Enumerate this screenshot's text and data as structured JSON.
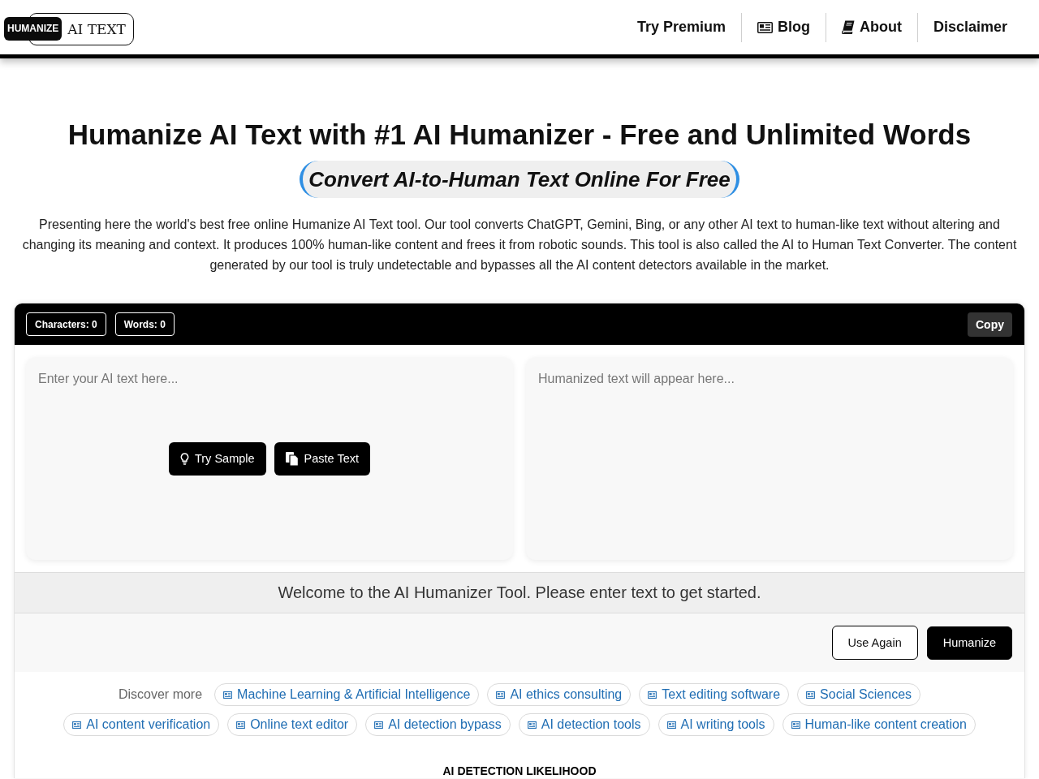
{
  "header": {
    "logo": {
      "badge": "HUMANIZE",
      "wordmark": "AI TEXT"
    },
    "nav": [
      {
        "label": "Try Premium"
      },
      {
        "label": "Blog"
      },
      {
        "label": "About"
      },
      {
        "label": "Disclaimer"
      }
    ]
  },
  "hero": {
    "title": "Humanize AI Text with #1 AI Humanizer - Free and Unlimited Words",
    "subtitle": "Convert AI-to-Human Text Online For Free",
    "description": "Presenting here the world's best free online Humanize AI Text tool. Our tool converts ChatGPT, Gemini, Bing, or any other AI text to human-like text without altering and changing its meaning and context. It produces 100% human-like content and frees it from robotic sounds. This tool is also called the AI to Human Text Converter. The content generated by our tool is truly undetectable and bypasses all the AI content detectors available in the market."
  },
  "editor": {
    "counters": [
      "Characters: 0",
      "Words: 0"
    ],
    "copy_button": "Copy",
    "input": {
      "placeholder": "Enter your AI text here..."
    },
    "input_buttons": [
      {
        "label": "Try Sample"
      },
      {
        "label": "Paste Text"
      }
    ],
    "output": {
      "placeholder": "Humanized text will appear here..."
    },
    "status": "Welcome to the AI Humanizer Tool. Please enter text to get started.",
    "actions": [
      {
        "label": "Use Again",
        "kind": "outline"
      },
      {
        "label": "Humanize",
        "kind": "solid"
      }
    ]
  },
  "discover": {
    "label": "Discover more",
    "links": [
      "Machine Learning & Artificial Intelligence",
      "AI ethics consulting",
      "Text editing software",
      "Social Sciences",
      "AI content verification",
      "Online text editor",
      "AI detection bypass",
      "AI detection tools",
      "AI writing tools",
      "Human-like content creation"
    ]
  },
  "section_heading": "AI DETECTION LIKELIHOOD"
}
